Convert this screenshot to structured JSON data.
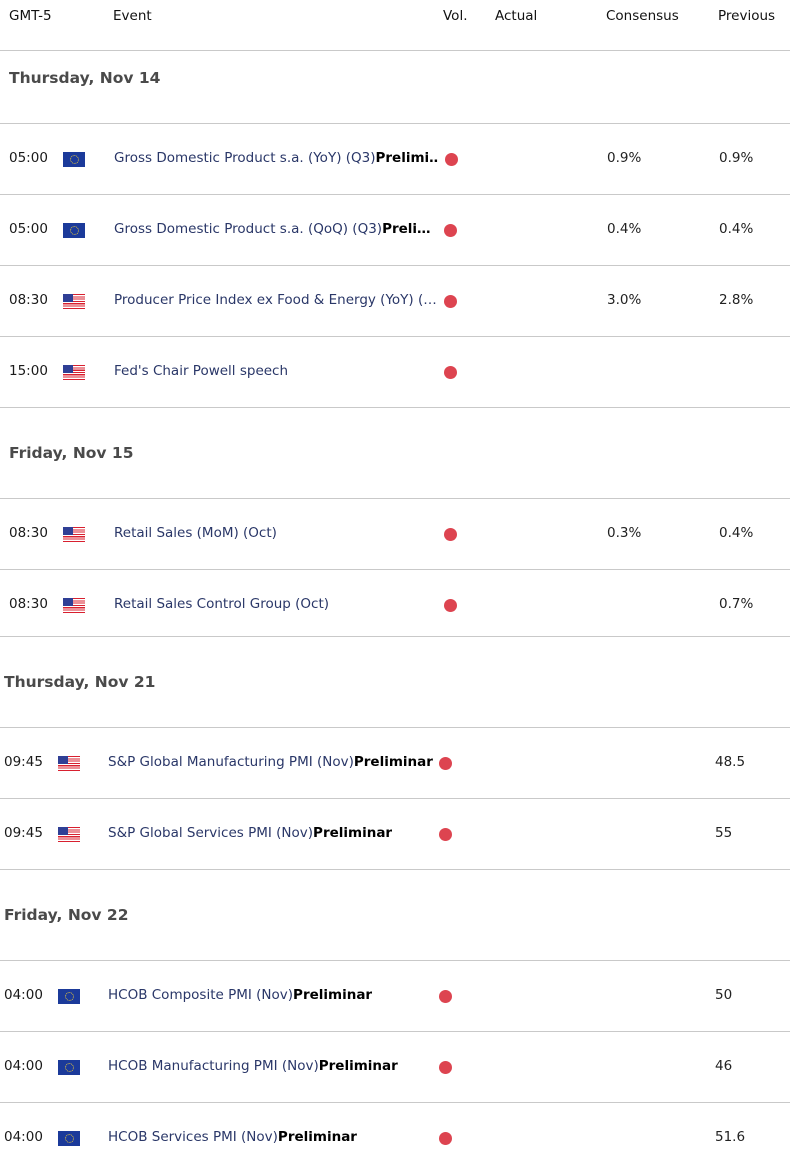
{
  "header": {
    "timezone": "GMT-5",
    "event": "Event",
    "vol": "Vol.",
    "actual": "Actual",
    "consensus": "Consensus",
    "previous": "Previous"
  },
  "colors": {
    "event_text": "#2a3768",
    "volatility_high": "#dd4450",
    "day_label": "#4a4a4a",
    "divider": "#c9c9c9"
  },
  "days": [
    {
      "label": "Thursday, Nov 14",
      "events": [
        {
          "time": "05:00",
          "country": "EU",
          "flag_icon": "eu-flag-icon",
          "name": "Gross Domestic Product s.a. (YoY) (Q3)",
          "suffix": "Prelimi…",
          "volatility": "high",
          "actual": "",
          "consensus": "0.9%",
          "previous": "0.9%"
        },
        {
          "time": "05:00",
          "country": "EU",
          "flag_icon": "eu-flag-icon",
          "name": "Gross Domestic Product s.a. (QoQ) (Q3)",
          "suffix": "Preli…",
          "volatility": "high",
          "actual": "",
          "consensus": "0.4%",
          "previous": "0.4%"
        },
        {
          "time": "08:30",
          "country": "US",
          "flag_icon": "us-flag-icon",
          "name": "Producer Price Index ex Food & Energy (YoY) (…",
          "suffix": "",
          "volatility": "high",
          "actual": "",
          "consensus": "3.0%",
          "previous": "2.8%"
        },
        {
          "time": "15:00",
          "country": "US",
          "flag_icon": "us-flag-icon",
          "name": "Fed's Chair Powell speech",
          "suffix": "",
          "volatility": "high",
          "actual": "",
          "consensus": "",
          "previous": ""
        }
      ]
    },
    {
      "label": "Friday, Nov 15",
      "events": [
        {
          "time": "08:30",
          "country": "US",
          "flag_icon": "us-flag-icon",
          "name": "Retail Sales (MoM) (Oct)",
          "suffix": "",
          "volatility": "high",
          "actual": "",
          "consensus": "0.3%",
          "previous": "0.4%"
        },
        {
          "time": "08:30",
          "country": "US",
          "flag_icon": "us-flag-icon",
          "name": "Retail Sales Control Group (Oct)",
          "suffix": "",
          "volatility": "high",
          "actual": "",
          "consensus": "",
          "previous": "0.7%"
        }
      ]
    },
    {
      "label": "Thursday, Nov 21",
      "events": [
        {
          "time": "09:45",
          "country": "US",
          "flag_icon": "us-flag-icon",
          "name": "S&P Global Manufacturing PMI (Nov)",
          "suffix": "Preliminar",
          "volatility": "high",
          "actual": "",
          "consensus": "",
          "previous": "48.5"
        },
        {
          "time": "09:45",
          "country": "US",
          "flag_icon": "us-flag-icon",
          "name": "S&P Global Services PMI (Nov)",
          "suffix": "Preliminar",
          "volatility": "high",
          "actual": "",
          "consensus": "",
          "previous": "55"
        }
      ]
    },
    {
      "label": "Friday, Nov 22",
      "events": [
        {
          "time": "04:00",
          "country": "EU",
          "flag_icon": "eu-flag-icon",
          "name": "HCOB Composite PMI (Nov)",
          "suffix": "Preliminar",
          "volatility": "high",
          "actual": "",
          "consensus": "",
          "previous": "50"
        },
        {
          "time": "04:00",
          "country": "EU",
          "flag_icon": "eu-flag-icon",
          "name": "HCOB Manufacturing PMI (Nov)",
          "suffix": "Preliminar",
          "volatility": "high",
          "actual": "",
          "consensus": "",
          "previous": "46"
        },
        {
          "time": "04:00",
          "country": "EU",
          "flag_icon": "eu-flag-icon",
          "name": "HCOB Services PMI (Nov)",
          "suffix": "Preliminar",
          "volatility": "high",
          "actual": "",
          "consensus": "",
          "previous": "51.6"
        }
      ]
    }
  ]
}
